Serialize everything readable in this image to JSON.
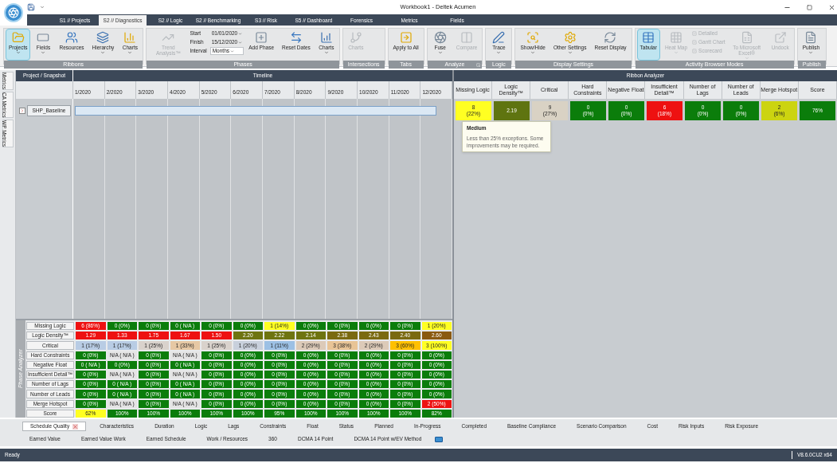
{
  "window": {
    "title": "Workbook1 - Deltek Acumen"
  },
  "menu_tabs": [
    {
      "label": "S1 // Projects",
      "selected": false
    },
    {
      "label": "S2 // Diagnostics",
      "selected": true
    },
    {
      "label": "S2 // Logic",
      "selected": false
    },
    {
      "label": "S2 // Benchmarking",
      "selected": false
    },
    {
      "label": "S3 // Risk",
      "selected": false
    },
    {
      "label": "S5 // Dashboard",
      "selected": false
    },
    {
      "label": "Forensics",
      "selected": false
    },
    {
      "label": "Metrics",
      "selected": false
    },
    {
      "label": "Fields",
      "selected": false
    }
  ],
  "ribbon": [
    {
      "label": "Ribbons",
      "launcher": false,
      "items": [
        {
          "kind": "button",
          "label": "Projects",
          "selected": true,
          "disabled": false,
          "dropdown": true
        },
        {
          "kind": "button",
          "label": "Fields",
          "selected": false,
          "disabled": false,
          "dropdown": true
        },
        {
          "kind": "button",
          "label": "Resources",
          "selected": false,
          "disabled": false,
          "dropdown": false
        },
        {
          "kind": "button",
          "label": "Hierarchy",
          "selected": false,
          "disabled": false,
          "dropdown": true
        },
        {
          "kind": "button",
          "label": "Charts",
          "selected": false,
          "disabled": false,
          "dropdown": true
        }
      ]
    },
    {
      "label": "Phases",
      "launcher": false,
      "items": [
        {
          "kind": "button",
          "label": "Trend Analysis™",
          "selected": false,
          "disabled": true,
          "dropdown": false
        },
        {
          "kind": "dates",
          "fields": [
            {
              "label": "Start",
              "value": "01/01/2020"
            },
            {
              "label": "Finish",
              "value": "15/12/2020"
            },
            {
              "label": "Interval",
              "value": "Months"
            }
          ]
        },
        {
          "kind": "button",
          "label": "Add Phase",
          "selected": false,
          "disabled": false,
          "dropdown": false
        },
        {
          "kind": "button",
          "label": "Reset Dates",
          "selected": false,
          "disabled": false,
          "dropdown": false
        },
        {
          "kind": "button",
          "label": "Charts",
          "selected": false,
          "disabled": false,
          "dropdown": true
        }
      ]
    },
    {
      "label": "Intersections",
      "launcher": false,
      "items": [
        {
          "kind": "button",
          "label": "Charts",
          "selected": false,
          "disabled": true,
          "dropdown": false
        }
      ]
    },
    {
      "label": "Tabs",
      "launcher": false,
      "items": [
        {
          "kind": "button",
          "label": "Apply to All",
          "selected": false,
          "disabled": false,
          "dropdown": false
        }
      ]
    },
    {
      "label": "Analyze",
      "launcher": true,
      "items": [
        {
          "kind": "button",
          "label": "Fuse",
          "selected": false,
          "disabled": false,
          "dropdown": true
        },
        {
          "kind": "button",
          "label": "Compare",
          "selected": false,
          "disabled": true,
          "dropdown": false
        }
      ]
    },
    {
      "label": "Logic",
      "launcher": false,
      "items": [
        {
          "kind": "button",
          "label": "Trace",
          "selected": false,
          "disabled": false,
          "dropdown": true
        }
      ]
    },
    {
      "label": "Display Settings",
      "launcher": false,
      "items": [
        {
          "kind": "button",
          "label": "Show/Hide",
          "selected": false,
          "disabled": false,
          "dropdown": true
        },
        {
          "kind": "button",
          "label": "Other Settings",
          "selected": false,
          "disabled": false,
          "dropdown": true
        },
        {
          "kind": "button",
          "label": "Reset Display",
          "selected": false,
          "disabled": false,
          "dropdown": false
        }
      ]
    },
    {
      "label": "Activity Browser Modes",
      "launcher": false,
      "items": [
        {
          "kind": "button",
          "label": "Tabular",
          "selected": true,
          "disabled": false,
          "dropdown": false
        },
        {
          "kind": "button",
          "label": "Heat Map",
          "selected": false,
          "disabled": true,
          "dropdown": true
        },
        {
          "kind": "checks",
          "items": [
            {
              "label": "Detailed",
              "disabled": true
            },
            {
              "label": "Gantt Chart",
              "disabled": true
            },
            {
              "label": "Scorecard",
              "disabled": true
            }
          ]
        },
        {
          "kind": "button",
          "label": "To Microsoft Excel®",
          "selected": false,
          "disabled": true,
          "dropdown": true
        },
        {
          "kind": "button",
          "label": "Undock",
          "selected": false,
          "disabled": true,
          "dropdown": false
        }
      ]
    },
    {
      "label": "Publish",
      "launcher": false,
      "items": [
        {
          "kind": "button",
          "label": "Publish",
          "selected": false,
          "disabled": false,
          "dropdown": true
        }
      ]
    }
  ],
  "side_tabs": [
    {
      "label": "Metrics"
    },
    {
      "label": "CA Metrics"
    },
    {
      "label": "WP Metrics"
    }
  ],
  "timeline": {
    "project_header": "Project / Snapshot",
    "header": "Timeline",
    "columns": [
      "1/2020",
      "2/2020",
      "3/2020",
      "4/2020",
      "5/2020",
      "6/2020",
      "7/2020",
      "8/2020",
      "9/2020",
      "10/2020",
      "11/2020",
      "12/2020"
    ],
    "projects": [
      {
        "name": "SHP_Baseline",
        "selected": true
      }
    ]
  },
  "phase_analyzer": {
    "label": "Phase Analyzer",
    "rows": [
      {
        "label": "Missing Logic",
        "cells": [
          {
            "text": "6 (86%)",
            "color": "#ee1111"
          },
          {
            "text": "0 (0%)",
            "color": "#0b7d0b"
          },
          {
            "text": "0 (0%)",
            "color": "#0b7d0b"
          },
          {
            "text": "0 ( N/A )",
            "color": "#0b7d0b"
          },
          {
            "text": "0 (0%)",
            "color": "#0b7d0b"
          },
          {
            "text": "0 (0%)",
            "color": "#0b7d0b"
          },
          {
            "text": "1 (14%)",
            "color": "#ffff22"
          },
          {
            "text": "0 (0%)",
            "color": "#0b7d0b"
          },
          {
            "text": "0 (0%)",
            "color": "#0b7d0b"
          },
          {
            "text": "0 (0%)",
            "color": "#0b7d0b"
          },
          {
            "text": "0 (0%)",
            "color": "#0b7d0b"
          },
          {
            "text": "1 (20%)",
            "color": "#ffff22"
          }
        ]
      },
      {
        "label": "Logic Density™",
        "cells": [
          {
            "text": "1.29",
            "color": "#ee1111"
          },
          {
            "text": "1.33",
            "color": "#ee1111"
          },
          {
            "text": "1.75",
            "color": "#ee1111"
          },
          {
            "text": "1.67",
            "color": "#ee1111"
          },
          {
            "text": "1.50",
            "color": "#ee1111"
          },
          {
            "text": "2.20",
            "color": "#6e7410"
          },
          {
            "text": "2.22",
            "color": "#6e7410"
          },
          {
            "text": "2.14",
            "color": "#6e7410"
          },
          {
            "text": "2.38",
            "color": "#7a6a10"
          },
          {
            "text": "2.43",
            "color": "#7a6a10"
          },
          {
            "text": "2.40",
            "color": "#7a6a10"
          },
          {
            "text": "2.60",
            "color": "#8a5a10"
          }
        ]
      },
      {
        "label": "Critical",
        "cells": [
          {
            "text": "1 (17%)",
            "color": "#b8cce4"
          },
          {
            "text": "1 (17%)",
            "color": "#b8cce4"
          },
          {
            "text": "1 (25%)",
            "color": "#d9d2cc"
          },
          {
            "text": "1 (33%)",
            "color": "#e6c8a4"
          },
          {
            "text": "1 (25%)",
            "color": "#d9d2cc"
          },
          {
            "text": "1 (20%)",
            "color": "#c8d0dc"
          },
          {
            "text": "1 (11%)",
            "color": "#9cc0e4"
          },
          {
            "text": "2 (29%)",
            "color": "#dccab8"
          },
          {
            "text": "3 (38%)",
            "color": "#e8c496"
          },
          {
            "text": "2 (29%)",
            "color": "#dccab8"
          },
          {
            "text": "3 (60%)",
            "color": "#ffc000"
          },
          {
            "text": "3 (100%)",
            "color": "#ffff22"
          }
        ]
      },
      {
        "label": "Hard Constraints",
        "cells": [
          {
            "text": "0 (0%)",
            "color": "#0b7d0b"
          },
          {
            "text": "N/A ( N/A )",
            "color": "#e4e4e4"
          },
          {
            "text": "0 (0%)",
            "color": "#0b7d0b"
          },
          {
            "text": "N/A ( N/A )",
            "color": "#e4e4e4"
          },
          {
            "text": "0 (0%)",
            "color": "#0b7d0b"
          },
          {
            "text": "0 (0%)",
            "color": "#0b7d0b"
          },
          {
            "text": "0 (0%)",
            "color": "#0b7d0b"
          },
          {
            "text": "0 (0%)",
            "color": "#0b7d0b"
          },
          {
            "text": "0 (0%)",
            "color": "#0b7d0b"
          },
          {
            "text": "0 (0%)",
            "color": "#0b7d0b"
          },
          {
            "text": "0 (0%)",
            "color": "#0b7d0b"
          },
          {
            "text": "0 (0%)",
            "color": "#0b7d0b"
          }
        ]
      },
      {
        "label": "Negative Float",
        "cells": [
          {
            "text": "0 ( N/A )",
            "color": "#0b7d0b"
          },
          {
            "text": "0 (0%)",
            "color": "#0b7d0b"
          },
          {
            "text": "0 (0%)",
            "color": "#0b7d0b"
          },
          {
            "text": "0 ( N/A )",
            "color": "#0b7d0b"
          },
          {
            "text": "0 (0%)",
            "color": "#0b7d0b"
          },
          {
            "text": "0 (0%)",
            "color": "#0b7d0b"
          },
          {
            "text": "0 (0%)",
            "color": "#0b7d0b"
          },
          {
            "text": "0 (0%)",
            "color": "#0b7d0b"
          },
          {
            "text": "0 (0%)",
            "color": "#0b7d0b"
          },
          {
            "text": "0 (0%)",
            "color": "#0b7d0b"
          },
          {
            "text": "0 (0%)",
            "color": "#0b7d0b"
          },
          {
            "text": "0 (0%)",
            "color": "#0b7d0b"
          }
        ]
      },
      {
        "label": "Insufficient Detail™",
        "cells": [
          {
            "text": "0 (0%)",
            "color": "#0b7d0b"
          },
          {
            "text": "N/A ( N/A )",
            "color": "#e4e4e4"
          },
          {
            "text": "0 (0%)",
            "color": "#0b7d0b"
          },
          {
            "text": "N/A ( N/A )",
            "color": "#e4e4e4"
          },
          {
            "text": "0 (0%)",
            "color": "#0b7d0b"
          },
          {
            "text": "0 (0%)",
            "color": "#0b7d0b"
          },
          {
            "text": "0 (0%)",
            "color": "#0b7d0b"
          },
          {
            "text": "0 (0%)",
            "color": "#0b7d0b"
          },
          {
            "text": "0 (0%)",
            "color": "#0b7d0b"
          },
          {
            "text": "0 (0%)",
            "color": "#0b7d0b"
          },
          {
            "text": "0 (0%)",
            "color": "#0b7d0b"
          },
          {
            "text": "0 (0%)",
            "color": "#0b7d0b"
          }
        ]
      },
      {
        "label": "Number of Lags",
        "cells": [
          {
            "text": "0 (0%)",
            "color": "#0b7d0b"
          },
          {
            "text": "0 ( N/A )",
            "color": "#0b7d0b"
          },
          {
            "text": "0 (0%)",
            "color": "#0b7d0b"
          },
          {
            "text": "0 ( N/A )",
            "color": "#0b7d0b"
          },
          {
            "text": "0 (0%)",
            "color": "#0b7d0b"
          },
          {
            "text": "0 (0%)",
            "color": "#0b7d0b"
          },
          {
            "text": "0 (0%)",
            "color": "#0b7d0b"
          },
          {
            "text": "0 (0%)",
            "color": "#0b7d0b"
          },
          {
            "text": "0 (0%)",
            "color": "#0b7d0b"
          },
          {
            "text": "0 (0%)",
            "color": "#0b7d0b"
          },
          {
            "text": "0 (0%)",
            "color": "#0b7d0b"
          },
          {
            "text": "0 (0%)",
            "color": "#0b7d0b"
          }
        ]
      },
      {
        "label": "Number of Leads",
        "cells": [
          {
            "text": "0 (0%)",
            "color": "#0b7d0b"
          },
          {
            "text": "0 ( N/A )",
            "color": "#0b7d0b"
          },
          {
            "text": "0 (0%)",
            "color": "#0b7d0b"
          },
          {
            "text": "0 ( N/A )",
            "color": "#0b7d0b"
          },
          {
            "text": "0 (0%)",
            "color": "#0b7d0b"
          },
          {
            "text": "0 (0%)",
            "color": "#0b7d0b"
          },
          {
            "text": "0 (0%)",
            "color": "#0b7d0b"
          },
          {
            "text": "0 (0%)",
            "color": "#0b7d0b"
          },
          {
            "text": "0 (0%)",
            "color": "#0b7d0b"
          },
          {
            "text": "0 (0%)",
            "color": "#0b7d0b"
          },
          {
            "text": "0 (0%)",
            "color": "#0b7d0b"
          },
          {
            "text": "0 (0%)",
            "color": "#0b7d0b"
          }
        ]
      },
      {
        "label": "Merge Hotspot",
        "cells": [
          {
            "text": "0 (0%)",
            "color": "#0b7d0b"
          },
          {
            "text": "N/A ( N/A )",
            "color": "#e4e4e4"
          },
          {
            "text": "0 (0%)",
            "color": "#0b7d0b"
          },
          {
            "text": "N/A ( N/A )",
            "color": "#e4e4e4"
          },
          {
            "text": "0 (0%)",
            "color": "#0b7d0b"
          },
          {
            "text": "0 (0%)",
            "color": "#0b7d0b"
          },
          {
            "text": "0 (0%)",
            "color": "#0b7d0b"
          },
          {
            "text": "0 (0%)",
            "color": "#0b7d0b"
          },
          {
            "text": "0 (0%)",
            "color": "#0b7d0b"
          },
          {
            "text": "0 (0%)",
            "color": "#0b7d0b"
          },
          {
            "text": "0 (0%)",
            "color": "#0b7d0b"
          },
          {
            "text": "2 (50%)",
            "color": "#ee1111"
          }
        ]
      },
      {
        "label": "Score",
        "cells": [
          {
            "text": "62%",
            "color": "#ffff22"
          },
          {
            "text": "100%",
            "color": "#0b7d0b"
          },
          {
            "text": "100%",
            "color": "#0b7d0b"
          },
          {
            "text": "100%",
            "color": "#0b7d0b"
          },
          {
            "text": "100%",
            "color": "#0b7d0b"
          },
          {
            "text": "100%",
            "color": "#0b7d0b"
          },
          {
            "text": "95%",
            "color": "#0b7d0b"
          },
          {
            "text": "100%",
            "color": "#0b7d0b"
          },
          {
            "text": "100%",
            "color": "#0b7d0b"
          },
          {
            "text": "100%",
            "color": "#0b7d0b"
          },
          {
            "text": "100%",
            "color": "#0b7d0b"
          },
          {
            "text": "82%",
            "color": "#0b7d0b"
          }
        ]
      }
    ]
  },
  "ribbon_analyzer": {
    "header": "Ribbon Analyzer",
    "columns": [
      "Missing Logic",
      "Logic Density™",
      "Critical",
      "Hard Constraints",
      "Negative Float",
      "Insufficient Detail™",
      "Number of Lags",
      "Number of Leads",
      "Merge Hotspot",
      "Score"
    ],
    "cells": [
      {
        "value": "8",
        "percent": "(22%)",
        "color": "#ffff22"
      },
      {
        "value": "2.19",
        "color": "#5f7410"
      },
      {
        "value": "9",
        "percent": "(27%)",
        "color": "#d9d2c4"
      },
      {
        "value": "0",
        "percent": "(0%)",
        "color": "#0b7d0b"
      },
      {
        "value": "0",
        "percent": "(0%)",
        "color": "#0b7d0b"
      },
      {
        "value": "6",
        "percent": "(18%)",
        "color": "#ee1111"
      },
      {
        "value": "0",
        "percent": "(0%)",
        "color": "#0b7d0b"
      },
      {
        "value": "0",
        "percent": "(0%)",
        "color": "#0b7d0b"
      },
      {
        "value": "2",
        "percent": "(6%)",
        "color": "#ccd410"
      },
      {
        "value": "76%",
        "color": "#0b7d0b"
      }
    ],
    "tooltip": {
      "title": "Medium",
      "text": "Less than 25% exceptions. Some improvements may be required."
    }
  },
  "bottom_tabs": [
    [
      {
        "label": "Schedule Quality",
        "selected": true
      },
      {
        "label": "Characteristics",
        "selected": false
      },
      {
        "label": "Duration",
        "selected": false
      },
      {
        "label": "Logic",
        "selected": false
      },
      {
        "label": "Lags",
        "selected": false
      },
      {
        "label": "Constraints",
        "selected": false
      },
      {
        "label": "Float",
        "selected": false
      },
      {
        "label": "Status",
        "selected": false
      },
      {
        "label": "Planned",
        "selected": false
      },
      {
        "label": "In-Progress",
        "selected": false
      },
      {
        "label": "Completed",
        "selected": false
      },
      {
        "label": "Baseline Compliance",
        "selected": false
      },
      {
        "label": "Scenario Comparison",
        "selected": false
      },
      {
        "label": "Cost",
        "selected": false
      },
      {
        "label": "Risk Inputs",
        "selected": false
      },
      {
        "label": "Risk Exposure",
        "selected": false
      }
    ],
    [
      {
        "label": "Earned Value",
        "selected": false
      },
      {
        "label": "Earned Value Work",
        "selected": false
      },
      {
        "label": "Earned Schedule",
        "selected": false
      },
      {
        "label": "Work / Resources",
        "selected": false
      },
      {
        "label": "360",
        "selected": false
      },
      {
        "label": "DCMA 14 Point",
        "selected": false
      },
      {
        "label": "DCMA 14 Point w/EV Method",
        "selected": false
      }
    ]
  ],
  "status_bar": {
    "left": "Ready",
    "right": "V8.6.0CU2 x64"
  }
}
